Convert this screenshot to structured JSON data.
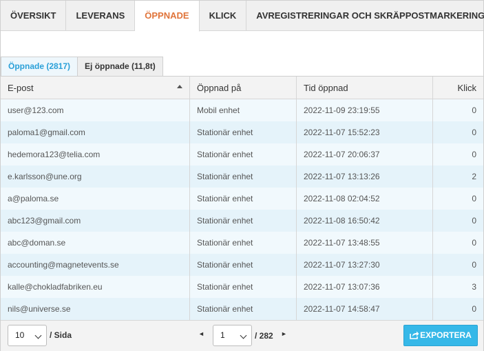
{
  "top_tabs": [
    "Översikt",
    "Leverans",
    "Öppnade",
    "Klick",
    "Avregistreringar och skräppostmarkeringar"
  ],
  "sub_tabs": [
    "Öppnade (2817)",
    "Ej öppnade (11,8t)"
  ],
  "table": {
    "headers": [
      "E-post",
      "Öppnad på",
      "Tid öppnad",
      "Klick"
    ],
    "rows": [
      [
        "user@123.com",
        "Mobil enhet",
        "2022-11-09 23:19:55",
        "0"
      ],
      [
        "paloma1@gmail.com",
        "Stationär enhet",
        "2022-11-07 15:52:23",
        "0"
      ],
      [
        "hedemora123@telia.com",
        "Stationär enhet",
        "2022-11-07 20:06:37",
        "0"
      ],
      [
        "e.karlsson@une.org",
        "Stationär enhet",
        "2022-11-07 13:13:26",
        "2"
      ],
      [
        "a@paloma.se",
        "Stationär enhet",
        "2022-11-08 02:04:52",
        "0"
      ],
      [
        "abc123@gmail.com",
        "Stationär enhet",
        "2022-11-08 16:50:42",
        "0"
      ],
      [
        "abc@doman.se",
        "Stationär enhet",
        "2022-11-07 13:48:55",
        "0"
      ],
      [
        "accounting@magnetevents.se",
        "Stationär enhet",
        "2022-11-07 13:27:30",
        "0"
      ],
      [
        "kalle@chokladfabriken.eu",
        "Stationär enhet",
        "2022-11-07 13:07:36",
        "3"
      ],
      [
        "nils@universe.se",
        "Stationär enhet",
        "2022-11-07 14:58:47",
        "0"
      ]
    ]
  },
  "footer": {
    "per_page_value": "10",
    "per_page_label": "/ Sida",
    "prev_icon": "◄",
    "page_value": "1",
    "total_pages": "/ 282",
    "next_icon": "►",
    "export_label": "EXPORTERA"
  },
  "colors": {
    "active_top_tab": "#e0743a",
    "active_sub_tab": "#2aa0d8",
    "export_button": "#36b8e8"
  }
}
